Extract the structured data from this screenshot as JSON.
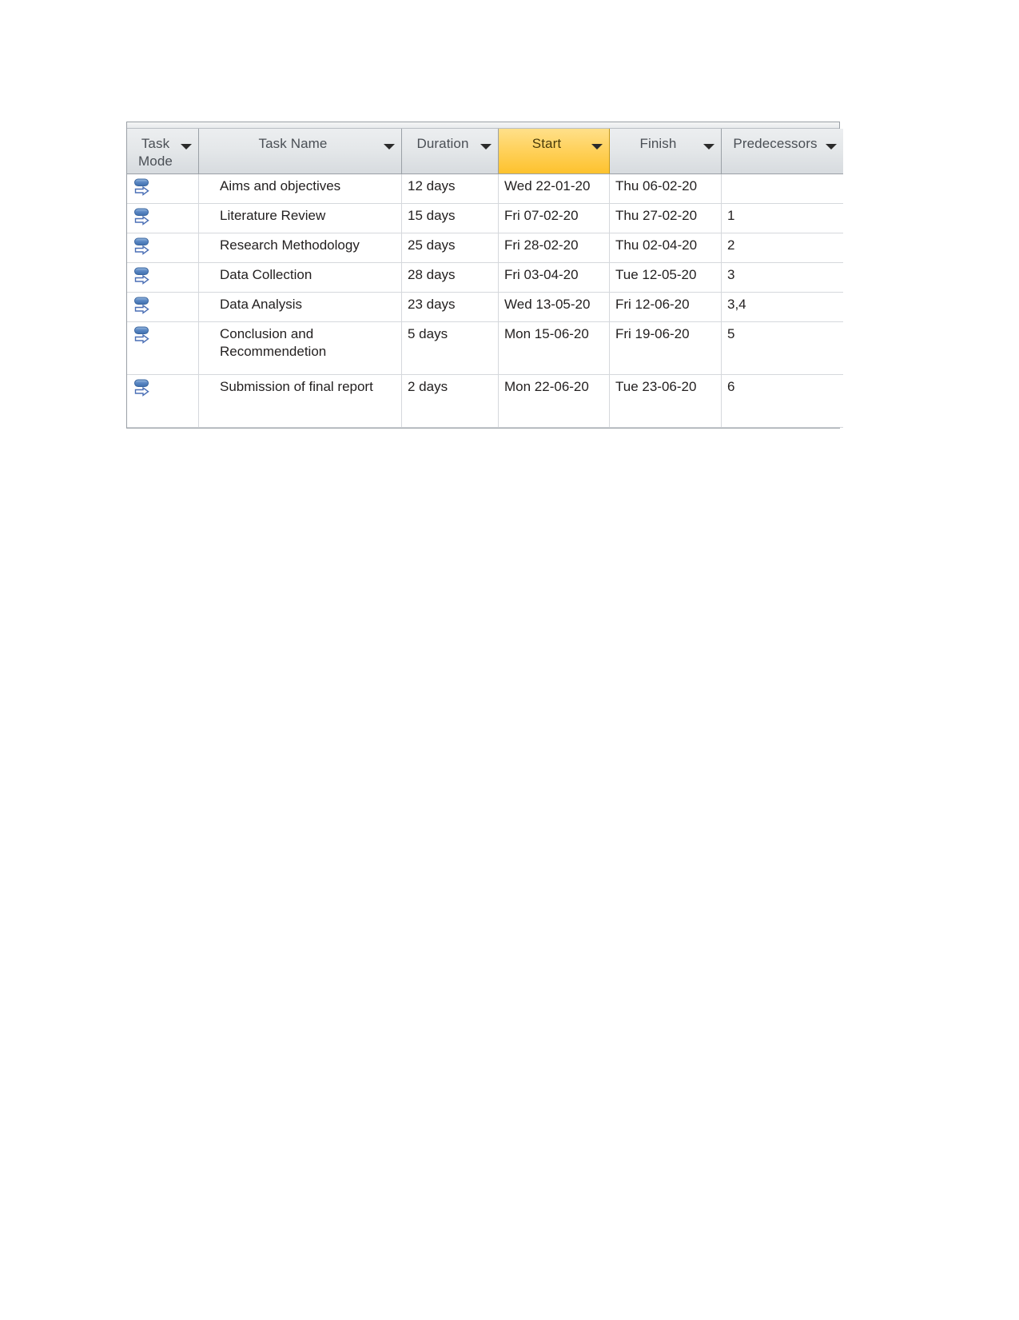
{
  "table": {
    "columns": [
      {
        "key": "mode",
        "label": "Task\nMode",
        "sorted": false,
        "has_filter_arrow": true
      },
      {
        "key": "name",
        "label": "Task Name",
        "sorted": false,
        "has_filter_arrow": true
      },
      {
        "key": "duration",
        "label": "Duration",
        "sorted": false,
        "has_filter_arrow": true
      },
      {
        "key": "start",
        "label": "Start",
        "sorted": true,
        "has_filter_arrow": true
      },
      {
        "key": "finish",
        "label": "Finish",
        "sorted": false,
        "has_filter_arrow": true
      },
      {
        "key": "pred",
        "label": "Predecessors",
        "sorted": false,
        "has_filter_arrow": true
      }
    ],
    "rows": [
      {
        "mode_icon": "auto-scheduled-icon",
        "name": "Aims and objectives",
        "duration": "12 days",
        "start": "Wed 22-01-20",
        "finish": "Thu 06-02-20",
        "pred": "",
        "tall": false
      },
      {
        "mode_icon": "auto-scheduled-icon",
        "name": "Literature Review",
        "duration": "15 days",
        "start": "Fri 07-02-20",
        "finish": "Thu 27-02-20",
        "pred": "1",
        "tall": false
      },
      {
        "mode_icon": "auto-scheduled-icon",
        "name": "Research Methodology",
        "duration": "25 days",
        "start": "Fri 28-02-20",
        "finish": "Thu 02-04-20",
        "pred": "2",
        "tall": false
      },
      {
        "mode_icon": "auto-scheduled-icon",
        "name": "Data Collection",
        "duration": "28 days",
        "start": "Fri 03-04-20",
        "finish": "Tue 12-05-20",
        "pred": "3",
        "tall": false
      },
      {
        "mode_icon": "auto-scheduled-icon",
        "name": "Data Analysis",
        "duration": "23 days",
        "start": "Wed 13-05-20",
        "finish": "Fri 12-06-20",
        "pred": "3,4",
        "tall": false
      },
      {
        "mode_icon": "auto-scheduled-icon",
        "name": "Conclusion and Recommendetion",
        "duration": "5 days",
        "start": "Mon 15-06-20",
        "finish": "Fri 19-06-20",
        "pred": "5",
        "tall": true
      },
      {
        "mode_icon": "auto-scheduled-icon",
        "name": "Submission of final report",
        "duration": "2 days",
        "start": "Mon 22-06-20",
        "finish": "Tue 23-06-20",
        "pred": "6",
        "tall": true
      }
    ]
  },
  "colors": {
    "header_gray": "#e4e7e9",
    "sorted_header_gold": "#ffd25e",
    "grid_line": "#d5d8dc",
    "outer_border": "#9aa0a6",
    "icon_blue": "#4f81bd",
    "text": "#221f1f"
  }
}
